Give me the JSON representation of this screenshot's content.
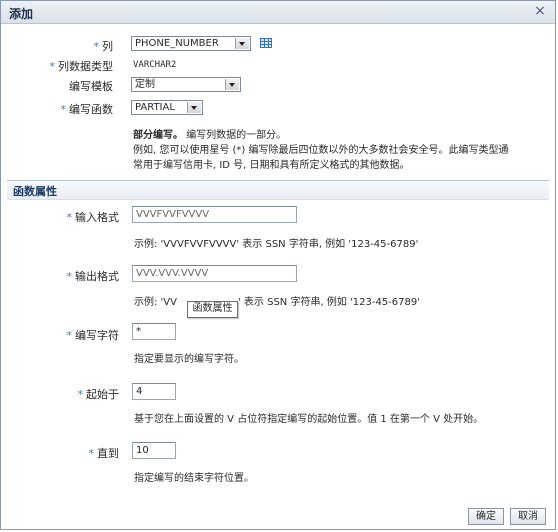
{
  "dialog": {
    "title": "添加",
    "close_icon": "close-icon"
  },
  "form": {
    "column_label": "列",
    "column_value": "PHONE_NUMBER",
    "datatype_label": "列数据类型",
    "datatype_value": "VARCHAR2",
    "template_label": "编写模板",
    "template_value": "定制",
    "function_label": "编写函数",
    "function_value": "PARTIAL",
    "desc_title": "部分编写。",
    "desc_title_rest": "编写列数据的一部分。",
    "desc_line2": "例如, 您可以使用星号 (*) 编写除最后四位数以外的大多数社会安全号。此编写类型通",
    "desc_line3": "常用于编写信用卡, ID 号, 日期和具有所定义格式的其他数据。"
  },
  "section": {
    "title": "函数属性"
  },
  "props": {
    "input_format_label": "输入格式",
    "input_format_value": "VVVFVVFVVVV",
    "input_format_hint": "示例: 'VVVFVVFVVVV' 表示 SSN 字符串, 例如 '123-45-6789'",
    "output_format_label": "输出格式",
    "output_format_value": "VVV.VVV.VVVV",
    "output_format_hint_a": "示例: 'VV",
    "output_format_hint_b": "' 表示 SSN 字符串, 例如 '123-45-6789'",
    "mask_char_label": "编写字符",
    "mask_char_value": "*",
    "mask_char_hint": "指定要显示的编写字符。",
    "start_label": "起始于",
    "start_value": "4",
    "start_hint": "基于您在上面设置的 V 占位符指定编写的起始位置。值 1 在第一个 V 处开始。",
    "end_label": "直到",
    "end_value": "10",
    "end_hint": "指定编写的结束字符位置。"
  },
  "tooltip": {
    "text": "函数属性"
  },
  "buttons": {
    "ok": "确定",
    "cancel": "取消"
  }
}
